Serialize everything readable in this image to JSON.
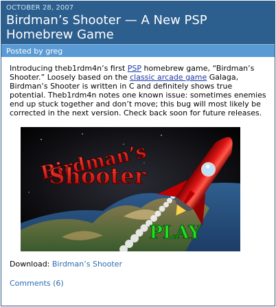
{
  "post": {
    "date": "OCTOBER 28, 2007",
    "title": "Birdman’s Shooter — A New PSP Homebrew Game",
    "byline": "Posted by greg",
    "body_parts": {
      "p1": "Introducing theb1rdm4n’s first ",
      "link1": "PSP",
      "p2": " homebrew game, “Birdman’s Shooter.” Loosely based on the ",
      "link2": "classic arcade game",
      "p3": " Galaga, Birdman’s Shooter is written in C and definitely shows true potential. Theb1rdm4n notes one known issue: sometimes enemies end up stuck together and don’t move; this bug will most likely be corrected in the next version. Check back soon for future releases."
    },
    "image": {
      "title_line1": "Birdman’s",
      "title_line2": "Shooter",
      "play_label": "PLAY"
    },
    "download_label": "Download: ",
    "download_link": "Birdman’s Shooter",
    "comments": "Comments (6)"
  },
  "colors": {
    "header_bg": "#2d5f8e",
    "byline_bg": "#5b9bd5",
    "link": "#1a36a8",
    "accent_link": "#2a6bb0"
  }
}
